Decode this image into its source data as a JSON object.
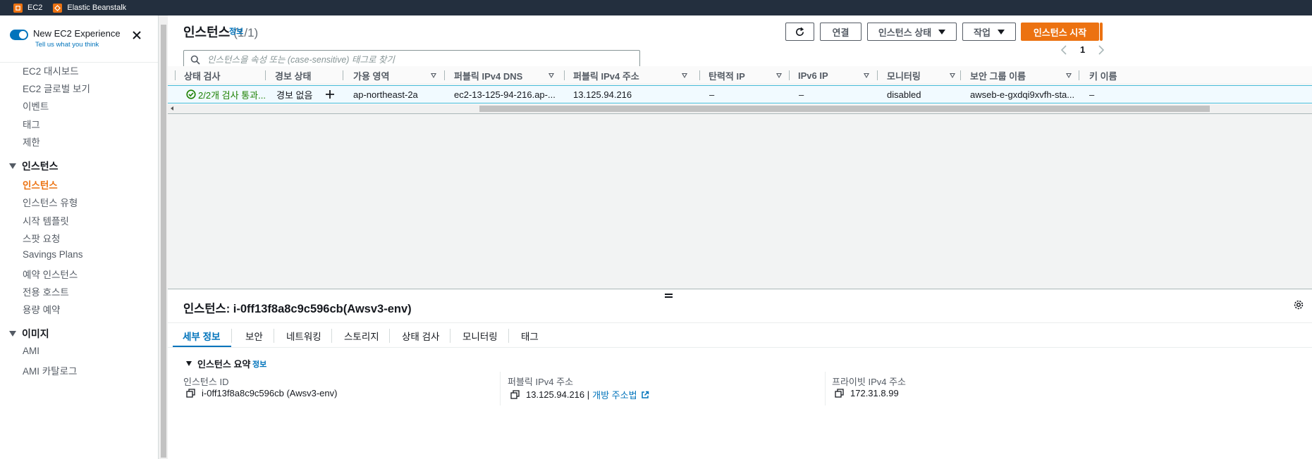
{
  "topbar": {
    "favorites": [
      {
        "label": "EC2",
        "icon": "ec2-icon"
      },
      {
        "label": "Elastic Beanstalk",
        "icon": "beanstalk-icon"
      }
    ]
  },
  "sidebar": {
    "experience_title": "New EC2 Experience",
    "experience_link": "Tell us what you think",
    "top_items": [
      "EC2 대시보드",
      "EC2 글로벌 보기",
      "이벤트",
      "태그",
      "제한"
    ],
    "sections": [
      {
        "title": "인스턴스",
        "items": [
          "인스턴스",
          "인스턴스 유형",
          "시작 템플릿",
          "스팟 요청",
          "Savings Plans",
          "예약 인스턴스",
          "전용 호스트",
          "용량 예약"
        ]
      },
      {
        "title": "이미지",
        "items": [
          "AMI",
          "AMI 카탈로그"
        ]
      }
    ],
    "active_item": "인스턴스"
  },
  "list": {
    "title": "인스턴스",
    "count": "(1/1)",
    "info": "정보",
    "search_placeholder": "인스턴스을 속성 또는 (case-sensitive) 태그로 찾기",
    "buttons": {
      "refresh": "refresh-icon",
      "connect": "연결",
      "instance_state": "인스턴스 상태",
      "actions": "작업",
      "launch": "인스턴스 시작"
    },
    "page": "1",
    "columns": [
      "상태 검사",
      "경보 상태",
      "가용 영역",
      "퍼블릭 IPv4 DNS",
      "퍼블릭 IPv4 주소",
      "탄력적 IP",
      "IPv6 IP",
      "모니터링",
      "보안 그룹 이름",
      "키 이름"
    ],
    "row": {
      "status_check": "2/2개 검사 통과...",
      "alarm_status": "경보 없음",
      "availability_zone": "ap-northeast-2a",
      "public_dns": "ec2-13-125-94-216.ap-...",
      "public_ipv4": "13.125.94.216",
      "elastic_ip": "–",
      "ipv6_ip": "–",
      "monitoring": "disabled",
      "security_group": "awseb-e-gxdqi9xvfh-sta...",
      "key_name": "–"
    },
    "colors": {
      "ok": "#1d8102",
      "accent": "#ec7211",
      "link": "#0073bb",
      "selected_bg": "#f1faff"
    }
  },
  "detail": {
    "title": "인스턴스: i-0ff13f8a8c9c596cb(Awsv3-env)",
    "tabs": [
      "세부 정보",
      "보안",
      "네트워킹",
      "스토리지",
      "상태 검사",
      "모니터링",
      "태그"
    ],
    "active_tab": "세부 정보",
    "summary_title": "인스턴스 요약",
    "summary_info": "정보",
    "fields": [
      {
        "label": "인스턴스 ID",
        "value": "i-0ff13f8a8c9c596cb (Awsv3-env)"
      },
      {
        "label": "퍼블릭 IPv4 주소",
        "value": "13.125.94.216 |",
        "link": "개방 주소법"
      },
      {
        "label": "프라이빗 IPv4 주소",
        "value": "172.31.8.99"
      }
    ]
  }
}
